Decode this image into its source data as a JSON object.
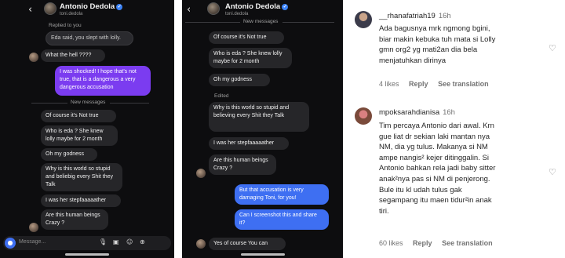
{
  "panel1": {
    "name": "Antonio Dedola",
    "handle": "toni.dedola",
    "replied_to": "Replied to you",
    "reply_quote": "Eda said, you slept with lolly.",
    "msg_what_hell": "What the hell ????",
    "msg_shocked": "I was shocked! I hope that's not true, that is a dangerous a very dangerous accusation",
    "new_messages": "New messages",
    "msg_not_true": "Of course it's Not true",
    "msg_who_eda": "Who is eda ? She knew lolly maybe for 2 month",
    "msg_godness": "Oh my godness",
    "msg_why_world": "Why is this world so stupid and beliebig every Shit they Talk",
    "msg_stepfa": "I was her stepfaaaaather",
    "msg_human": "Are this human beings Crazy ?",
    "composer_placeholder": "Message..."
  },
  "panel2": {
    "name": "Antonio Dedola",
    "handle": "toni.dedola",
    "new_messages": "New messages",
    "msg_not_true": "Of course it's Not true",
    "msg_who_eda": "Who is eda ? She knew lolly maybe for 2 month",
    "msg_godness": "Oh my godness",
    "edited": "Edited",
    "msg_why_world": "Why is this world so stupid and believing every Shit they Talk",
    "msg_stepfa": "I was her stepfaaaaather",
    "msg_human": "Are this human beings Crazy ?",
    "msg_accusation": "But that accusation is very damaging Toni, for you!",
    "msg_screenshot": "Can I screenshot this and share it?",
    "msg_yes": "Yes of course You can"
  },
  "comments": [
    {
      "username": "__rhanafatriah19",
      "ago": "16h",
      "text_lines": [
        "Ada bagusnya mrk ngmong bgini,",
        "biar makin kebuka tuh mata si Lolly",
        "gmn org2 yg mati2an dia bela",
        "menjatuhkan dirinya"
      ],
      "likes": "4 likes",
      "reply": "Reply",
      "see_translation": "See translation"
    },
    {
      "username": "mpoksarahdianisa",
      "ago": "16h",
      "text_lines": [
        "Tim percaya Antonio dari awal. Krn",
        "gue liat dr sekian laki mantan nya",
        "NM, dia yg tulus. Makanya si NM",
        "ampe nangis² kejer ditinggalin. Si",
        "Antonio bahkan rela jadi baby sitter",
        "anak²nya pas si NM di penjerong.",
        "Bule itu kl udah tulus gak",
        "segampang itu maen tidur²in anak",
        "tiri."
      ],
      "likes": "60 likes",
      "reply": "Reply",
      "see_translation": "See translation"
    }
  ],
  "icons": {
    "back": "chevron-left-icon",
    "verified": "verified-badge-icon",
    "camera": "camera-icon",
    "mic": "microphone-icon",
    "gallery": "gallery-icon",
    "sticker": "sticker-icon",
    "add": "plus-circle-icon",
    "heart": "heart-outline-icon"
  },
  "colors": {
    "dm_background": "#0d0d0f",
    "incoming_bubble": "#262629",
    "outgoing_purple": "#7b3cf0",
    "outgoing_blue": "#3e6ff2",
    "verified_blue": "#3b82f6"
  }
}
